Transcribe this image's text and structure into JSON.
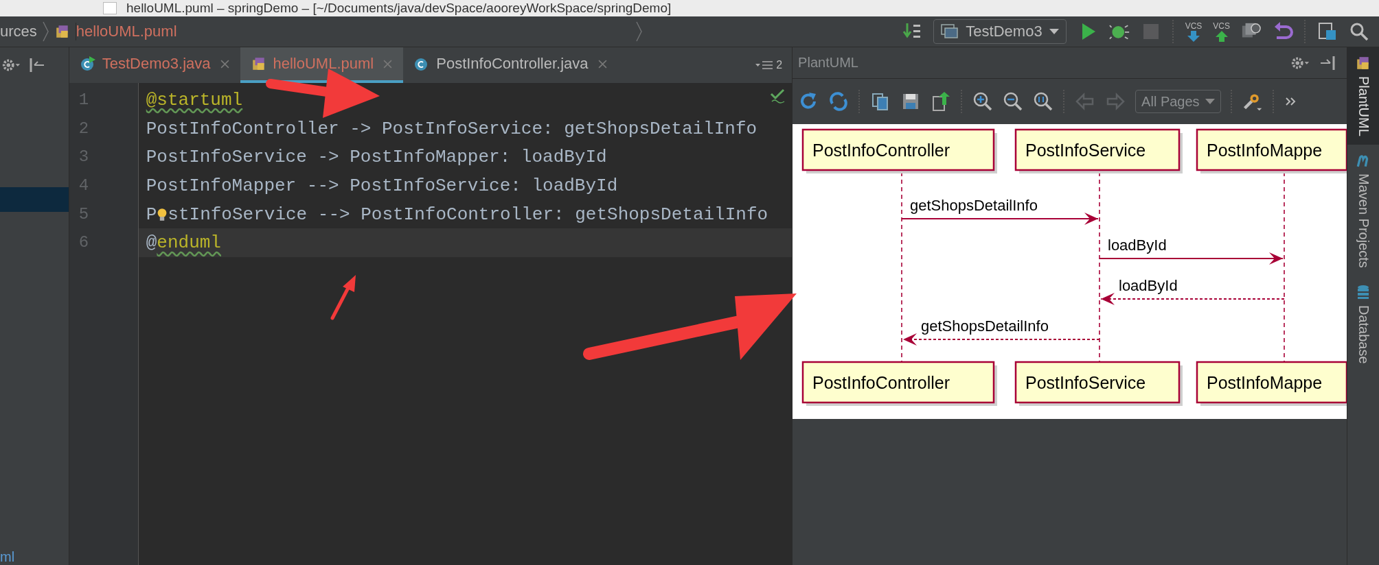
{
  "window": {
    "title": "helloUML.puml – springDemo – [~/Documents/java/devSpace/aooreyWorkSpace/springDemo]"
  },
  "breadcrumbs": [
    {
      "label": "urces",
      "kind": "folder"
    },
    {
      "label": "helloUML.puml",
      "kind": "puml"
    }
  ],
  "run_config": {
    "label": "TestDemo3"
  },
  "vcs_buttons": [
    {
      "label": "VCS",
      "kind": "update"
    },
    {
      "label": "VCS",
      "kind": "commit"
    }
  ],
  "tabs": [
    {
      "label": "TestDemo3.java",
      "kind": "java-run",
      "selected": false,
      "color": "#d0705f"
    },
    {
      "label": "helloUML.puml",
      "kind": "puml",
      "selected": true,
      "color": "#d0705f"
    },
    {
      "label": "PostInfoController.java",
      "kind": "java",
      "selected": false,
      "color": "#bbbbbb"
    }
  ],
  "tab_overflow": {
    "count": "2"
  },
  "editor": {
    "lines": [
      {
        "number": "1",
        "tokens": [
          {
            "text": "@startuml",
            "kind": "directive",
            "warning": true
          }
        ]
      },
      {
        "number": "2",
        "tokens": [
          {
            "text": "PostInfoController -> PostInfoService: getShopsDetailInfo",
            "kind": "plain",
            "warning": false
          }
        ]
      },
      {
        "number": "3",
        "tokens": [
          {
            "text": "PostInfoService -> PostInfoMapper: loadById",
            "kind": "plain",
            "warning": false
          }
        ]
      },
      {
        "number": "4",
        "tokens": [
          {
            "text": "PostInfoMapper --> PostInfoService: loadById",
            "kind": "plain",
            "warning": false
          }
        ]
      },
      {
        "number": "5",
        "tokens": [
          {
            "text": "P",
            "kind": "plain",
            "warning": false
          },
          {
            "kind": "bulb"
          },
          {
            "text": "stInfoService --> PostInfoController: getShopsDetailInfo",
            "kind": "plain",
            "warning": false
          }
        ]
      },
      {
        "number": "6",
        "current": true,
        "tokens": [
          {
            "text": "@",
            "kind": "plain",
            "warning": false
          },
          {
            "text": "enduml",
            "kind": "directive",
            "warning": true
          }
        ]
      }
    ]
  },
  "project_tree": {
    "selected_row": true,
    "partial_label": "ml"
  },
  "plantuml": {
    "title": "PlantUML",
    "pages": "All Pages",
    "diagram": {
      "top_participants": [
        "PostInfoController",
        "PostInfoService",
        "PostInfoMappe"
      ],
      "messages": [
        {
          "label": "getShopsDetailInfo",
          "kind": "solid"
        },
        {
          "label": "loadById",
          "kind": "solid"
        },
        {
          "label": "loadById",
          "kind": "dashed"
        },
        {
          "label": "getShopsDetailInfo",
          "kind": "dashed"
        }
      ],
      "bottom_participants": [
        "PostInfoController",
        "PostInfoService",
        "PostInfoMappe"
      ]
    }
  },
  "side_tabs": [
    {
      "label": "PlantUML",
      "kind": "plantuml",
      "selected": true
    },
    {
      "label": "Maven Projects",
      "kind": "maven",
      "selected": false
    },
    {
      "label": "Database",
      "kind": "database",
      "selected": false
    }
  ]
}
